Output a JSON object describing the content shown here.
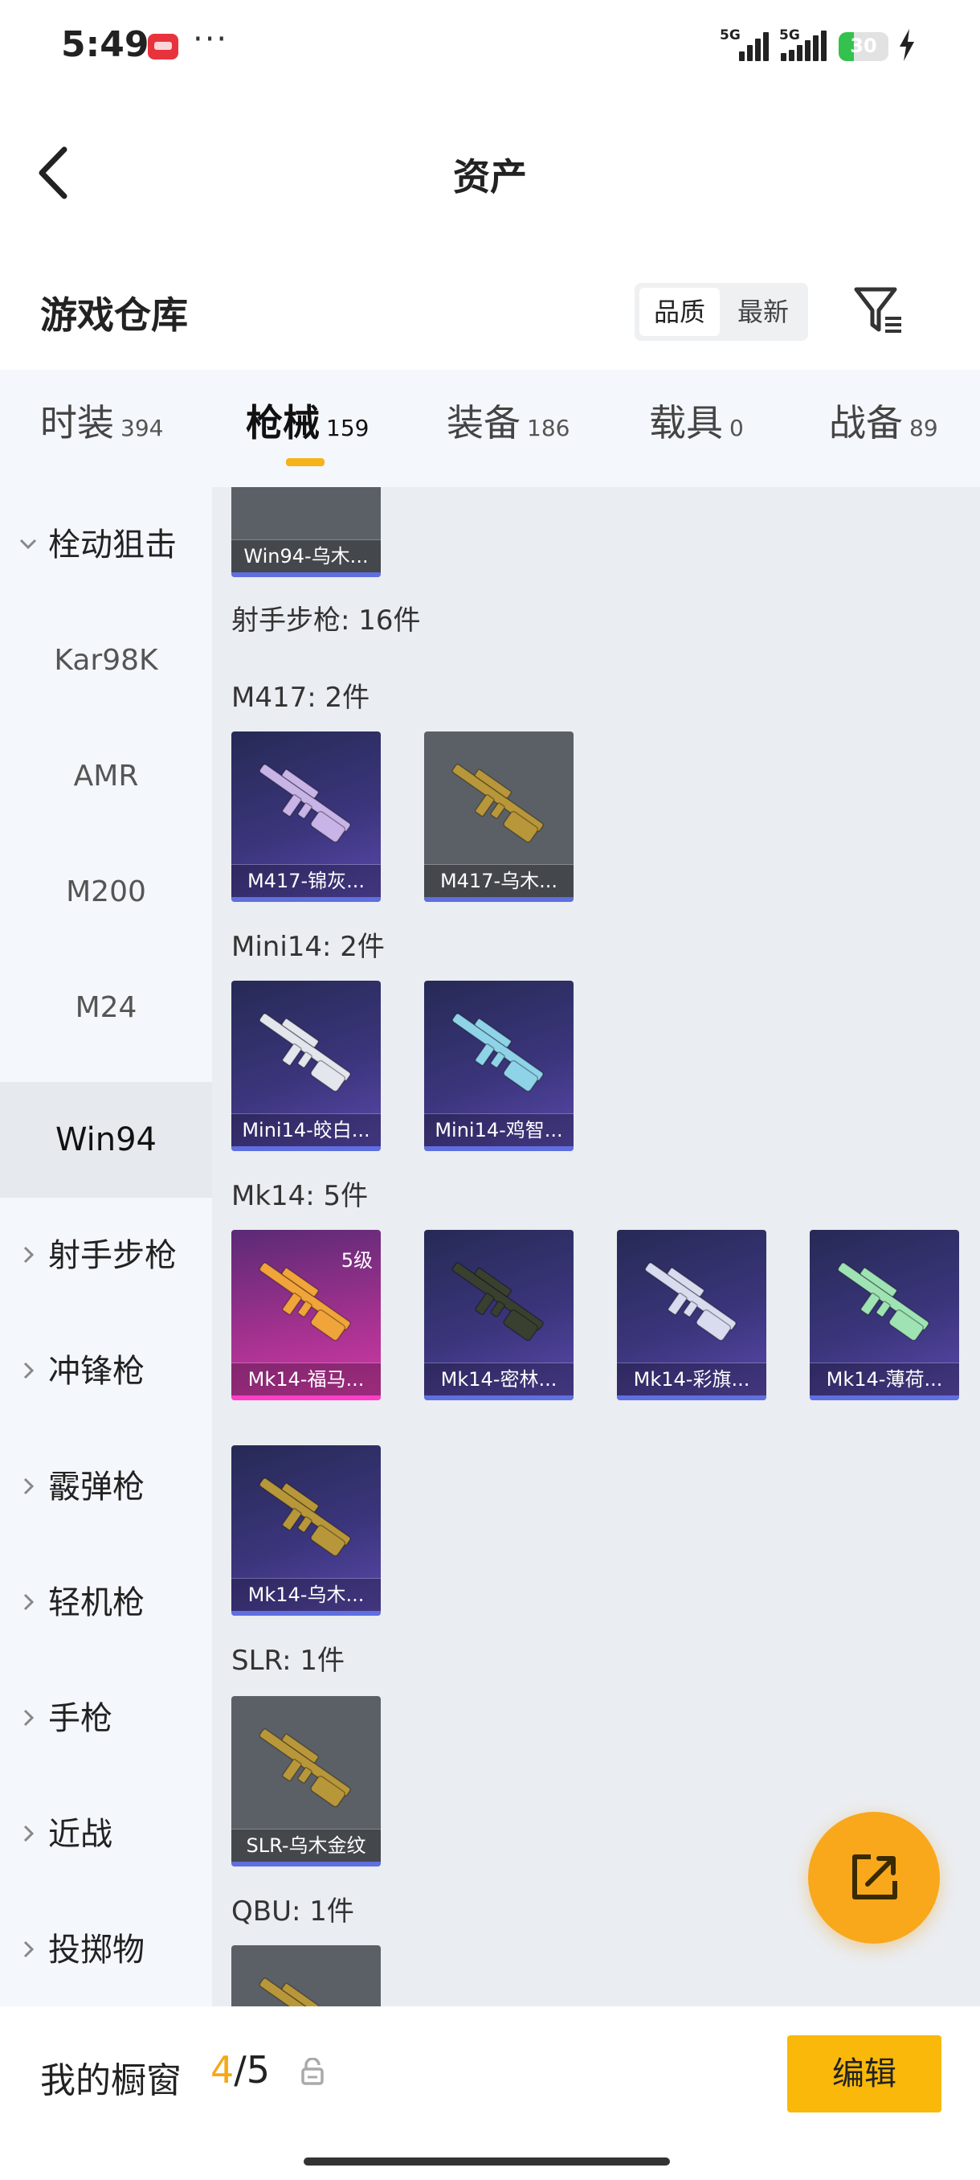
{
  "status_bar": {
    "time": "5:49",
    "more": "···",
    "sig1_label": "5G",
    "sig2_label": "5G",
    "battery": "30",
    "battery_level": 0.3
  },
  "header": {
    "title": "资产"
  },
  "section": {
    "title": "游戏仓库",
    "sort_options": [
      "品质",
      "最新"
    ],
    "sort_selected": "品质"
  },
  "tabs": [
    {
      "label": "时装",
      "count": "394"
    },
    {
      "label": "枪械",
      "count": "159"
    },
    {
      "label": "装备",
      "count": "186"
    },
    {
      "label": "载具",
      "count": "0"
    },
    {
      "label": "战备",
      "count": "89"
    }
  ],
  "sidebar": {
    "top_category": "栓动狙击",
    "sub_items": [
      "Kar98K",
      "AMR",
      "M200",
      "M24",
      "Win94"
    ],
    "categories": [
      "射手步枪",
      "冲锋枪",
      "霰弹枪",
      "轻机枪",
      "手枪",
      "近战",
      "投掷物"
    ]
  },
  "content": {
    "partial_card": "Win94-乌木...",
    "section_header": "射手步枪: 16件",
    "groups": [
      {
        "label": "M417: 2件",
        "items": [
          {
            "name": "M417-锦灰...",
            "style": "purple",
            "gun": "#c8b4e6"
          },
          {
            "name": "M417-乌木...",
            "style": "gray",
            "gun": "#b8973a"
          }
        ]
      },
      {
        "label": "Mini14: 2件",
        "items": [
          {
            "name": "Mini14-皎白...",
            "style": "purple",
            "gun": "#e4e6ee"
          },
          {
            "name": "Mini14-鸡智...",
            "style": "purple",
            "gun": "#8fd3e8"
          }
        ]
      },
      {
        "label": "Mk14: 5件",
        "items": [
          {
            "name": "Mk14-福马...",
            "style": "pink",
            "gun": "#f0a43a",
            "level": "5级"
          },
          {
            "name": "Mk14-密林...",
            "style": "purple",
            "gun": "#3a4030"
          },
          {
            "name": "Mk14-彩旗...",
            "style": "purple",
            "gun": "#d9dcef"
          },
          {
            "name": "Mk14-薄荷...",
            "style": "purple",
            "gun": "#9fe3b5"
          },
          {
            "name": "Mk14-乌木...",
            "style": "purple",
            "gun": "#b8973a"
          }
        ]
      },
      {
        "label": "SLR: 1件",
        "items": [
          {
            "name": "SLR-乌木金纹",
            "style": "gray",
            "gun": "#b8973a"
          }
        ]
      },
      {
        "label": "QBU: 1件",
        "items": [
          {
            "name": "",
            "style": "gray",
            "gun": "#b8973a"
          }
        ]
      }
    ]
  },
  "bottom": {
    "window_label": "我的橱窗",
    "count_current": "4",
    "count_total": "/5",
    "edit_label": "编辑"
  }
}
